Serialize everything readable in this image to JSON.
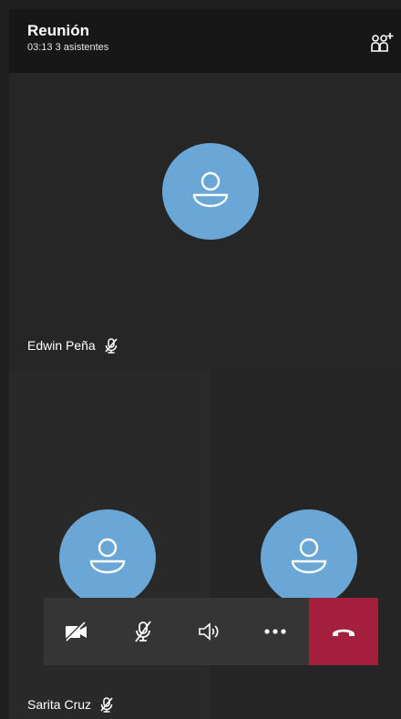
{
  "meeting": {
    "title": "Reunión",
    "subtitle": "03:13  3 asistentes"
  },
  "participants": [
    {
      "name": "Edwin Peña",
      "muted": true
    },
    {
      "name": "Sarita Cruz",
      "muted": true
    },
    {
      "name": "",
      "muted": false
    }
  ],
  "controls": [
    {
      "icon": "video-off-icon"
    },
    {
      "icon": "mic-off-icon"
    },
    {
      "icon": "speaker-icon"
    },
    {
      "icon": "more-icon"
    },
    {
      "icon": "hang-up-icon"
    }
  ],
  "colors": {
    "avatar": "#6aa6d6",
    "hangup": "#a5203f",
    "control_bar": "#353535"
  }
}
